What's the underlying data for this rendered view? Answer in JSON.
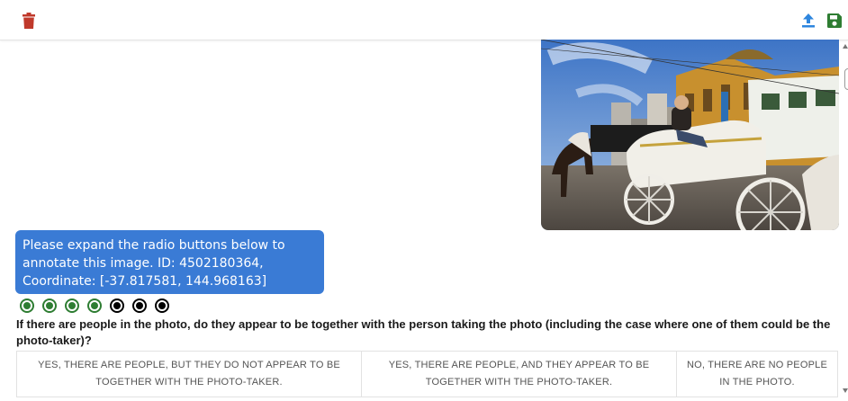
{
  "toolbar": {
    "delete_icon": "trash-icon",
    "upload_icon": "upload-icon",
    "save_icon": "save-icon",
    "colors": {
      "delete": "#c0392b",
      "upload": "#2e86de",
      "save": "#2e7d32"
    }
  },
  "image": {
    "alt": "Horse-drawn carriage in front of a railway station"
  },
  "instruction": {
    "text": "Please expand the radio buttons below to annotate this image. ID: 4502180364, Coordinate: [-37.817581, 144.968163]",
    "color": "#3a7bd5"
  },
  "progress": {
    "completed": 4,
    "total": 7,
    "completed_color": "#2e7d32",
    "pending_color": "#000000"
  },
  "question": {
    "text": "If there are people in the photo, do they appear to be together with the person taking the photo (including the case where one of them could be the photo-taker)?"
  },
  "options": [
    {
      "label": "YES, THERE ARE PEOPLE, BUT THEY DO NOT APPEAR TO BE TOGETHER WITH THE PHOTO-TAKER."
    },
    {
      "label": "YES, THERE ARE PEOPLE, AND THEY APPEAR TO BE TOGETHER WITH THE PHOTO-TAKER."
    },
    {
      "label": "NO, THERE ARE NO PEOPLE IN THE PHOTO."
    }
  ]
}
